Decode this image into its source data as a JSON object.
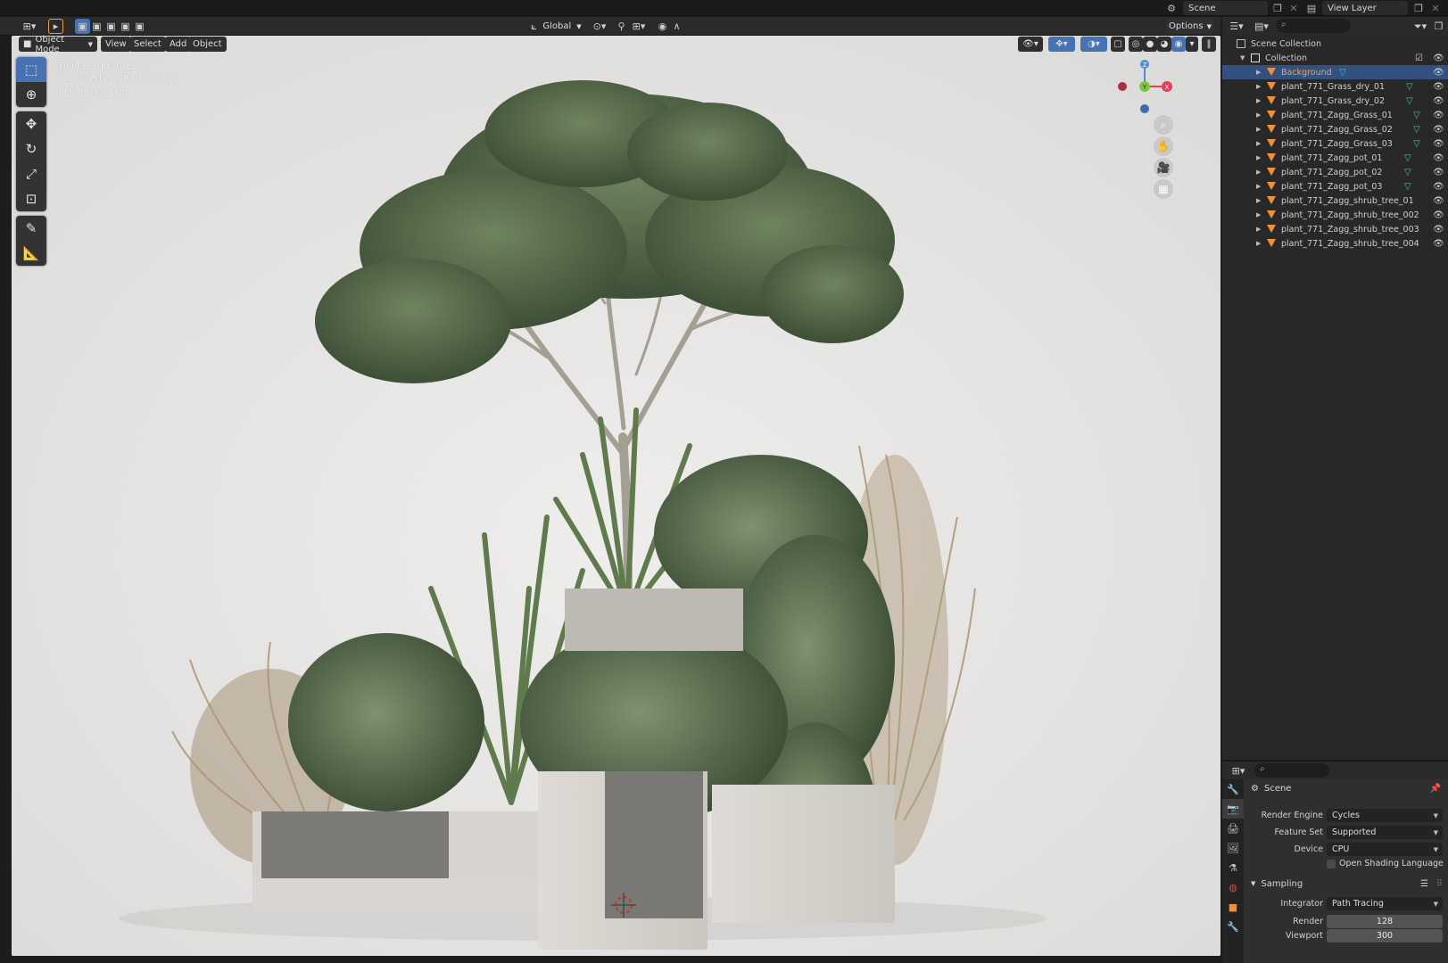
{
  "topbar": {
    "scene_label": "Scene",
    "view_layer_label": "View Layer"
  },
  "viewport_header": {
    "mode_label": "Object Mode",
    "menu": [
      "View",
      "Select",
      "Add",
      "Object"
    ],
    "transform_orientation": "Global",
    "options_label": "Options"
  },
  "viewport": {
    "info_lines": [
      "Front Perspective",
      "(1) Collection | Background",
      "Rendering Done"
    ],
    "gizmo": {
      "z": "Z",
      "y": "Y",
      "x": "X"
    }
  },
  "outliner": {
    "root": "Scene Collection",
    "collection": "Collection",
    "items": [
      {
        "name": "Background",
        "selected": true
      },
      {
        "name": "plant_771_Grass_dry_01",
        "selected": false
      },
      {
        "name": "plant_771_Grass_dry_02",
        "selected": false
      },
      {
        "name": "plant_771_Zagg_Grass_01",
        "selected": false
      },
      {
        "name": "plant_771_Zagg_Grass_02",
        "selected": false
      },
      {
        "name": "plant_771_Zagg_Grass_03",
        "selected": false
      },
      {
        "name": "plant_771_Zagg_pot_01",
        "selected": false
      },
      {
        "name": "plant_771_Zagg_pot_02",
        "selected": false
      },
      {
        "name": "plant_771_Zagg_pot_03",
        "selected": false
      },
      {
        "name": "plant_771_Zagg_shrub_tree_01",
        "selected": false
      },
      {
        "name": "plant_771_Zagg_shrub_tree_002",
        "selected": false
      },
      {
        "name": "plant_771_Zagg_shrub_tree_003",
        "selected": false
      },
      {
        "name": "plant_771_Zagg_shrub_tree_004",
        "selected": false
      }
    ]
  },
  "properties": {
    "context": "Scene",
    "render_engine_label": "Render Engine",
    "render_engine_value": "Cycles",
    "feature_set_label": "Feature Set",
    "feature_set_value": "Supported",
    "device_label": "Device",
    "device_value": "CPU",
    "osl_label": "Open Shading Language",
    "sampling_label": "Sampling",
    "integrator_label": "Integrator",
    "integrator_value": "Path Tracing",
    "render_label": "Render",
    "render_value": "128",
    "viewport_label": "Viewport",
    "viewport_value": "300"
  },
  "colors": {
    "accent": "#4772b3",
    "selected_text": "#f2a24a",
    "mesh_icon": "#39c79a",
    "object_icon": "#f08f3c",
    "viewport_bg": "#e7e6e5"
  }
}
